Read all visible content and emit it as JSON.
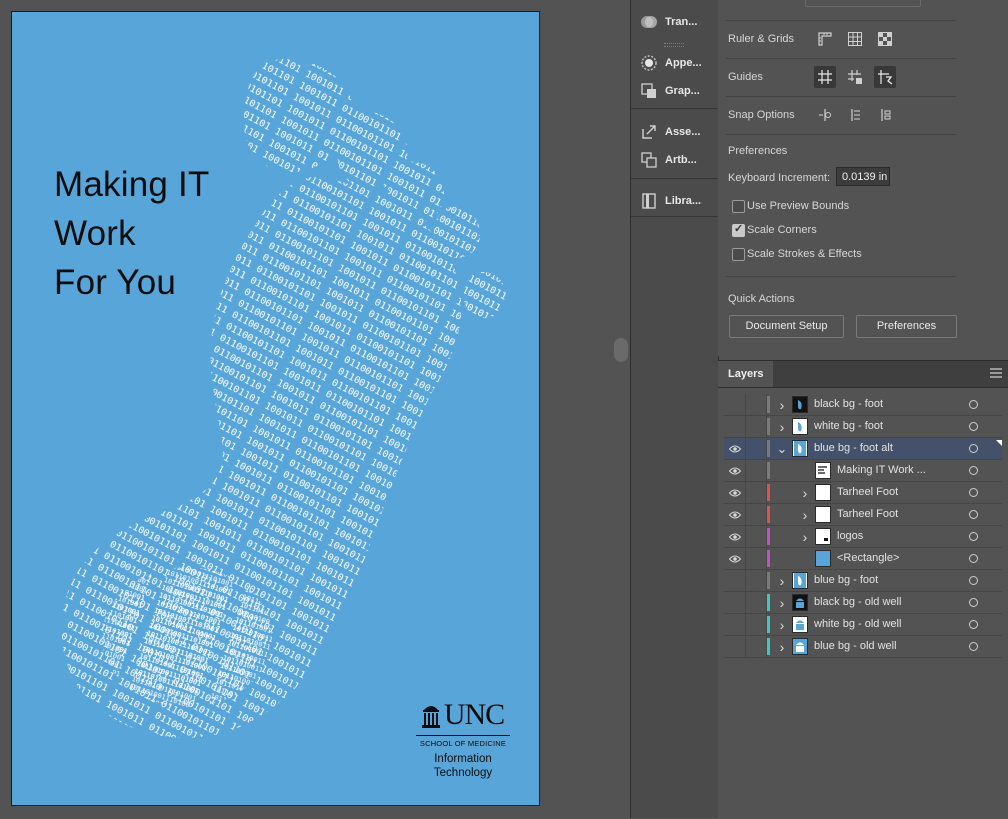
{
  "artboard": {
    "headline": [
      "Making IT",
      "Work",
      "For You"
    ],
    "logo": {
      "wordmark": "UNC",
      "school": "SCHOOL OF MEDICINE",
      "dept_line1": "Information",
      "dept_line2": "Technology"
    },
    "foot_fill": "binary digits"
  },
  "icon_panel": {
    "items": [
      {
        "label": "Tran...",
        "icon": "transparency-icon"
      },
      {
        "label": "Appe...",
        "icon": "appearance-icon"
      },
      {
        "label": "Grap...",
        "icon": "graphic-styles-icon"
      },
      {
        "label": "Asse...",
        "icon": "asset-export-icon"
      },
      {
        "label": "Artb...",
        "icon": "artboards-icon"
      },
      {
        "label": "Libra...",
        "icon": "libraries-icon"
      }
    ]
  },
  "properties": {
    "ruler_grids_label": "Ruler & Grids",
    "guides_label": "Guides",
    "snap_label": "Snap Options",
    "preferences_heading": "Preferences",
    "keyboard_increment_label": "Keyboard Increment:",
    "keyboard_increment_value": "0.0139 in",
    "use_preview_bounds": {
      "label": "Use Preview Bounds",
      "checked": false
    },
    "scale_corners": {
      "label": "Scale Corners",
      "checked": true
    },
    "scale_strokes": {
      "label": "Scale Strokes & Effects",
      "checked": false
    },
    "quick_actions_heading": "Quick Actions",
    "document_setup_label": "Document Setup",
    "preferences_button_label": "Preferences"
  },
  "layers": {
    "tab_label": "Layers",
    "rows": [
      {
        "name": "black bg - foot",
        "visible": false,
        "color": "#7a7a7a",
        "indent": 0,
        "expand": "collapsed",
        "thumb": "black",
        "selected": false
      },
      {
        "name": "white bg - foot",
        "visible": false,
        "color": "#7a7a7a",
        "indent": 0,
        "expand": "collapsed",
        "thumb": "white",
        "selected": false
      },
      {
        "name": "blue bg - foot alt",
        "visible": true,
        "color": "#7a7a7a",
        "indent": 0,
        "expand": "expanded",
        "thumb": "blue",
        "selected": true
      },
      {
        "name": "Making IT  Work ...",
        "visible": true,
        "color": "#7a7a7a",
        "indent": 1,
        "expand": "none",
        "thumb": "text",
        "selected": false
      },
      {
        "name": "Tarheel Foot",
        "visible": true,
        "color": "#d9534f",
        "indent": 1,
        "expand": "collapsed",
        "thumb": "blank",
        "selected": false
      },
      {
        "name": "Tarheel Foot",
        "visible": true,
        "color": "#d9534f",
        "indent": 1,
        "expand": "collapsed",
        "thumb": "blank",
        "selected": false
      },
      {
        "name": "logos",
        "visible": true,
        "color": "#c251c2",
        "indent": 1,
        "expand": "collapsed",
        "thumb": "logo",
        "selected": false
      },
      {
        "name": "<Rectangle>",
        "visible": true,
        "color": "#c251c2",
        "indent": 1,
        "expand": "none",
        "thumb": "rect",
        "selected": false
      },
      {
        "name": "blue bg - foot",
        "visible": false,
        "color": "#7a7a7a",
        "indent": 0,
        "expand": "collapsed",
        "thumb": "blue",
        "selected": false
      },
      {
        "name": "black bg - old well",
        "visible": false,
        "color": "#3fc7c4",
        "indent": 0,
        "expand": "collapsed",
        "thumb": "well-black",
        "selected": false
      },
      {
        "name": "white bg - old well",
        "visible": false,
        "color": "#3fc7c4",
        "indent": 0,
        "expand": "collapsed",
        "thumb": "well-white",
        "selected": false
      },
      {
        "name": "blue bg - old well",
        "visible": false,
        "color": "#3fc7c4",
        "indent": 0,
        "expand": "collapsed",
        "thumb": "well-blue",
        "selected": false
      }
    ]
  }
}
